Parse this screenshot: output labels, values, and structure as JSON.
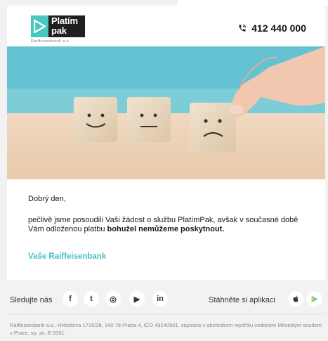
{
  "brand": {
    "logo_line1": "Platím",
    "logo_line2": "pak",
    "logo_sub": "Raiffeisenbank a.s.",
    "accent": "#46c0bd",
    "dark": "#1f1f1f"
  },
  "header": {
    "phone_icon": "phone-icon",
    "phone": "412 440 000"
  },
  "email": {
    "greeting": "Dobrý den,",
    "para_prefix": "pečlivě jsme posoudili Vaši žádost o službu PlatímPak, avšak v současné době Vám odloženou platbu ",
    "para_bold": "bohužel nemůžeme poskytnout.",
    "signature": "Vaše Raiffeisenbank"
  },
  "footer": {
    "follow_label": "Sledujte nás",
    "social_icons": [
      "facebook-icon",
      "twitter-icon",
      "instagram-icon",
      "youtube-icon",
      "linkedin-icon"
    ],
    "social_glyphs": [
      "f",
      "t",
      "◎",
      "▶",
      "in"
    ],
    "apps_label": "Stáhněte si aplikaci",
    "app_icons": [
      "apple-icon",
      "google-play-icon"
    ],
    "legal": "Raiffeisenbank a.s., Hvězdova 1716/2b, 140 78 Praha 4, IČO 49240901, zapsaná v obchodním rejstříku vedeném Městským soudem v Praze, sp. zn. B 2051."
  }
}
